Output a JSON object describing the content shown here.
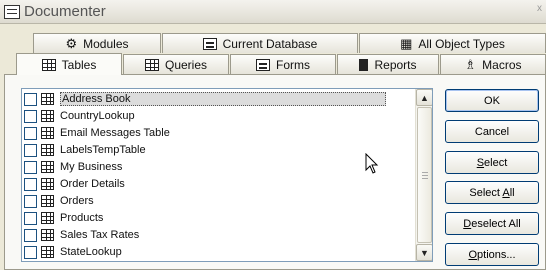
{
  "window": {
    "title": "Documenter",
    "close_glyph": "x"
  },
  "tabs_back": [
    {
      "label": "Modules",
      "icon": "modules-icon"
    },
    {
      "label": "Current Database",
      "icon": "current-database-icon"
    },
    {
      "label": "All Object Types",
      "icon": "all-object-types-icon"
    }
  ],
  "tabs_front": [
    {
      "label": "Tables",
      "icon": "table-icon",
      "active": true
    },
    {
      "label": "Queries",
      "icon": "queries-icon"
    },
    {
      "label": "Forms",
      "icon": "forms-icon"
    },
    {
      "label": "Reports",
      "icon": "reports-icon"
    },
    {
      "label": "Macros",
      "icon": "macros-icon"
    }
  ],
  "list": {
    "items": [
      "Address Book",
      "CountryLookup",
      "Email Messages Table",
      "LabelsTempTable",
      "My Business",
      "Order Details",
      "Orders",
      "Products",
      "Sales Tax Rates",
      "StateLookup"
    ],
    "selected_index": 0
  },
  "buttons": {
    "ok": "OK",
    "cancel": "Cancel",
    "select_prefix": "",
    "select_underline": "S",
    "select_rest": "elect",
    "select_all_prefix": "Select ",
    "select_all_underline": "A",
    "select_all_rest": "ll",
    "deselect_prefix": "",
    "deselect_underline": "D",
    "deselect_rest": "eselect All",
    "options_prefix": "",
    "options_underline": "O",
    "options_rest": "ptions..."
  }
}
